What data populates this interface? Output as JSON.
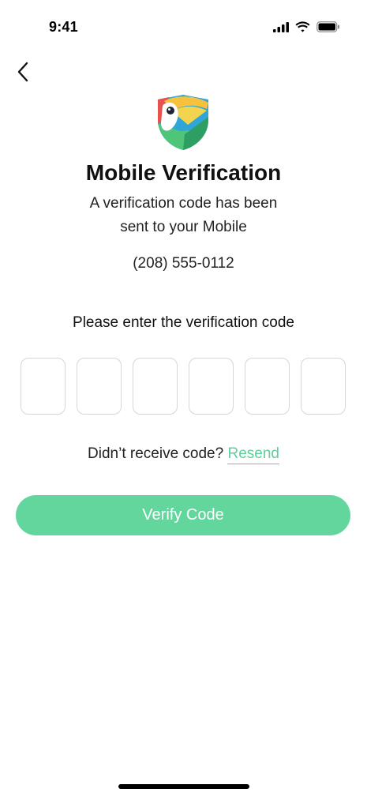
{
  "status_bar": {
    "time": "9:41",
    "icons": [
      "cellular-signal-icon",
      "wifi-icon",
      "battery-icon"
    ]
  },
  "header": {
    "back_icon": "chevron-left-icon"
  },
  "logo": {
    "name": "toucan-shield-logo"
  },
  "content": {
    "title": "Mobile Verification",
    "subtitle_line1": "A verification code has been",
    "subtitle_line2": "sent to your Mobile",
    "phone_number": "(208) 555-0112",
    "prompt": "Please enter the verification code",
    "code_digits": [
      "",
      "",
      "",
      "",
      "",
      ""
    ]
  },
  "resend": {
    "question": "Didn’t receive code?",
    "link_label": "Resend"
  },
  "actions": {
    "verify_label": "Verify Code"
  },
  "colors": {
    "accent": "#63d69e",
    "link": "#5dcf9b",
    "box_border": "#d6d6d6"
  }
}
